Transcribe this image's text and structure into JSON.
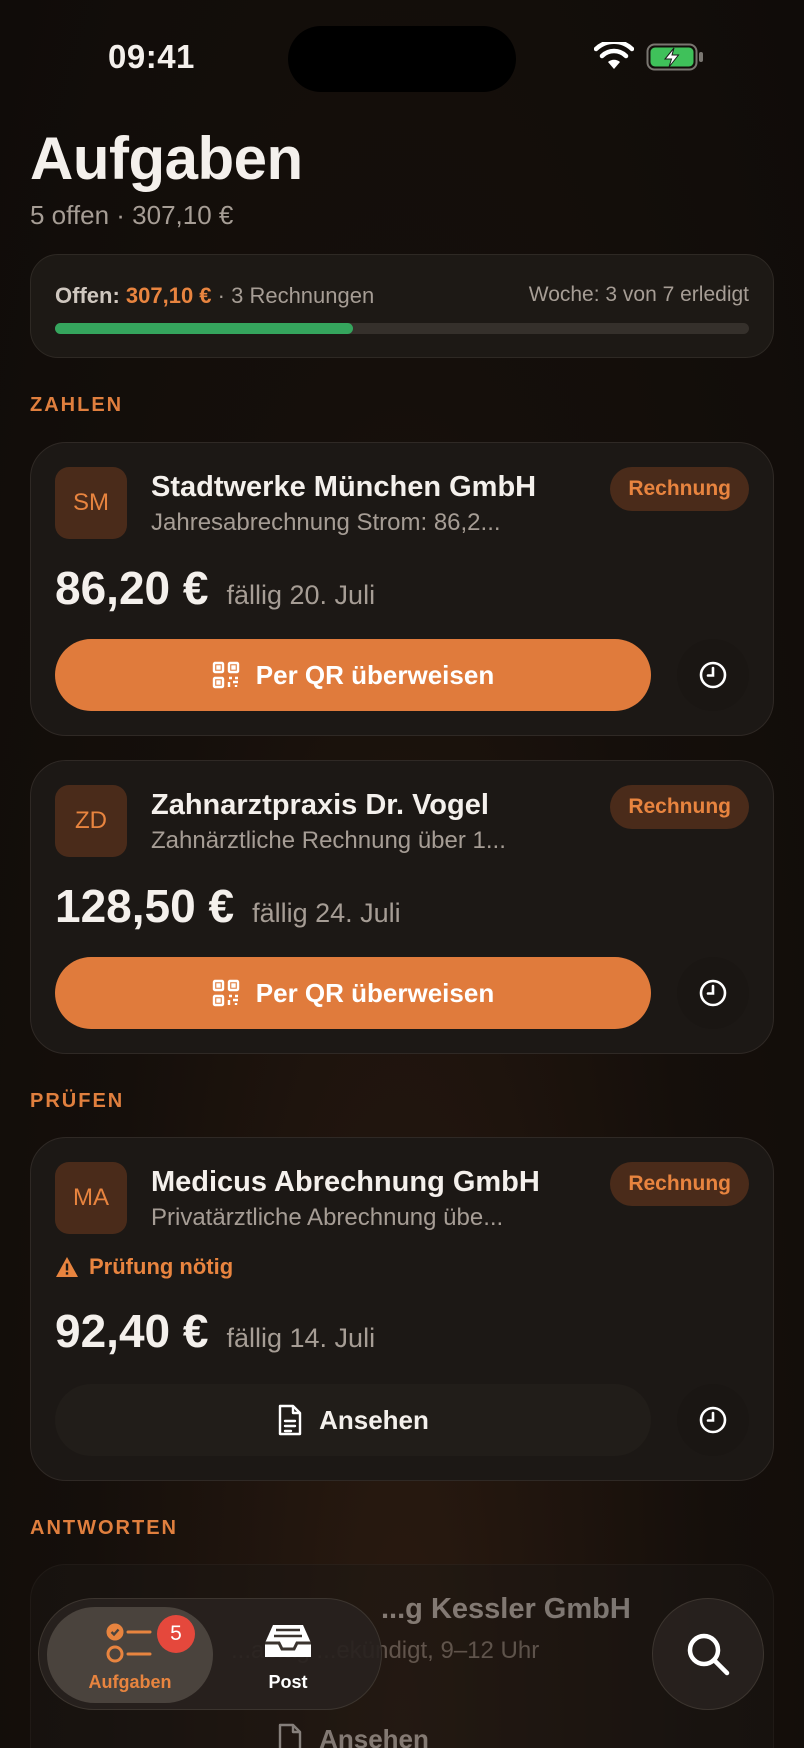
{
  "status_bar": {
    "time": "09:41"
  },
  "header": {
    "title": "Aufgaben",
    "subtitle": "5 offen · 307,10 €"
  },
  "summary": {
    "open_label": "Offen:",
    "open_amount": "307,10 €",
    "open_count": "· 3 Rechnungen",
    "week_status": "Woche: 3 von 7 erledigt",
    "week_progress": 0.43,
    "progress_color": "#35a55d"
  },
  "sections": {
    "pay": "ZAHLEN",
    "review": "PRÜFEN",
    "reply": "ANTWORTEN"
  },
  "cards": [
    {
      "initials": "SM",
      "sender": "Stadtwerke München GmbH",
      "description": "Jahresabrechnung Strom: 86,2...",
      "tag": "Rechnung",
      "amount": "86,20 €",
      "due": "fällig 20. Juli",
      "action": "Per QR überweisen"
    },
    {
      "initials": "ZD",
      "sender": "Zahnarztpraxis Dr. Vogel",
      "description": "Zahnärztliche Rechnung über 1...",
      "tag": "Rechnung",
      "amount": "128,50 €",
      "due": "fällig 24. Juli",
      "action": "Per QR überweisen"
    },
    {
      "initials": "MA",
      "sender": "Medicus Abrechnung GmbH",
      "description": "Privatärztliche Abrechnung übe...",
      "tag": "Rechnung",
      "warning": "Prüfung nötig",
      "amount": "92,40 €",
      "due": "fällig 14. Juli",
      "action": "Ansehen"
    },
    {
      "sender": "...g Kessler GmbH",
      "description": "...ablag ...ekündigt, 9–12 Uhr",
      "action": "Ansehen"
    }
  ],
  "tabbar": {
    "tasks_label": "Aufgaben",
    "tasks_badge": "5",
    "post_label": "Post"
  },
  "colors": {
    "accent": "#e07b3c",
    "background": "#120e0b",
    "card": "#1c1815",
    "badge": "#e5483c"
  },
  "icons": [
    "wifi-icon",
    "battery-charging-icon",
    "qr-code-icon",
    "clock-icon",
    "warning-icon",
    "document-icon",
    "tasks-icon",
    "inbox-icon",
    "search-icon"
  ]
}
